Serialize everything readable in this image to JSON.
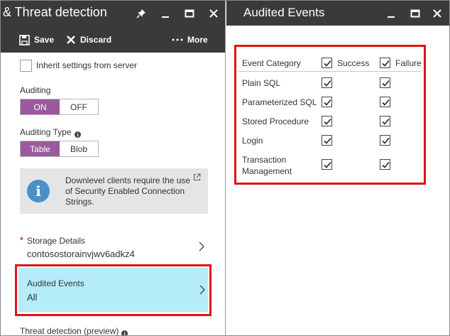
{
  "left_blade": {
    "title": "& Threat detection",
    "toolbar": {
      "save_label": "Save",
      "discard_label": "Discard",
      "more_label": "More"
    },
    "inherit_label": "Inherit settings from server",
    "auditing_label": "Auditing",
    "auditing_options": [
      "ON",
      "OFF"
    ],
    "auditing_selected": "ON",
    "auditing_type_label": "Auditing Type",
    "auditing_type_options": [
      "Table",
      "Blob"
    ],
    "auditing_type_selected": "Table",
    "info_text": "Downlevel clients require the use of Security Enabled Connection Strings.",
    "storage_required_mark": "*",
    "storage_label": "Storage Details",
    "storage_value": "contosostorainvjwv6adkz4",
    "audited_events_label": "Audited Events",
    "audited_events_value": "All",
    "threat_detection_label": "Threat detection (preview)"
  },
  "right_blade": {
    "title": "Audited Events",
    "headers": {
      "category": "Event Category",
      "success": "Success",
      "failure": "Failure"
    },
    "header_success_checked": true,
    "header_failure_checked": true,
    "rows": [
      {
        "label": "Plain SQL",
        "success": true,
        "failure": true
      },
      {
        "label": "Parameterized SQL",
        "success": true,
        "failure": true
      },
      {
        "label": "Stored Procedure",
        "success": true,
        "failure": true
      },
      {
        "label": "Login",
        "success": true,
        "failure": true
      },
      {
        "label_line1": "Transaction",
        "label_line2": "Management",
        "success": true,
        "failure": true
      }
    ]
  },
  "colors": {
    "titlebar": "#3a3a3a",
    "toggle_selected": "#9a5a9d",
    "selected_row": "#b5ecf9",
    "highlight_border": "#e0131a",
    "info_icon": "#4a90c8"
  }
}
